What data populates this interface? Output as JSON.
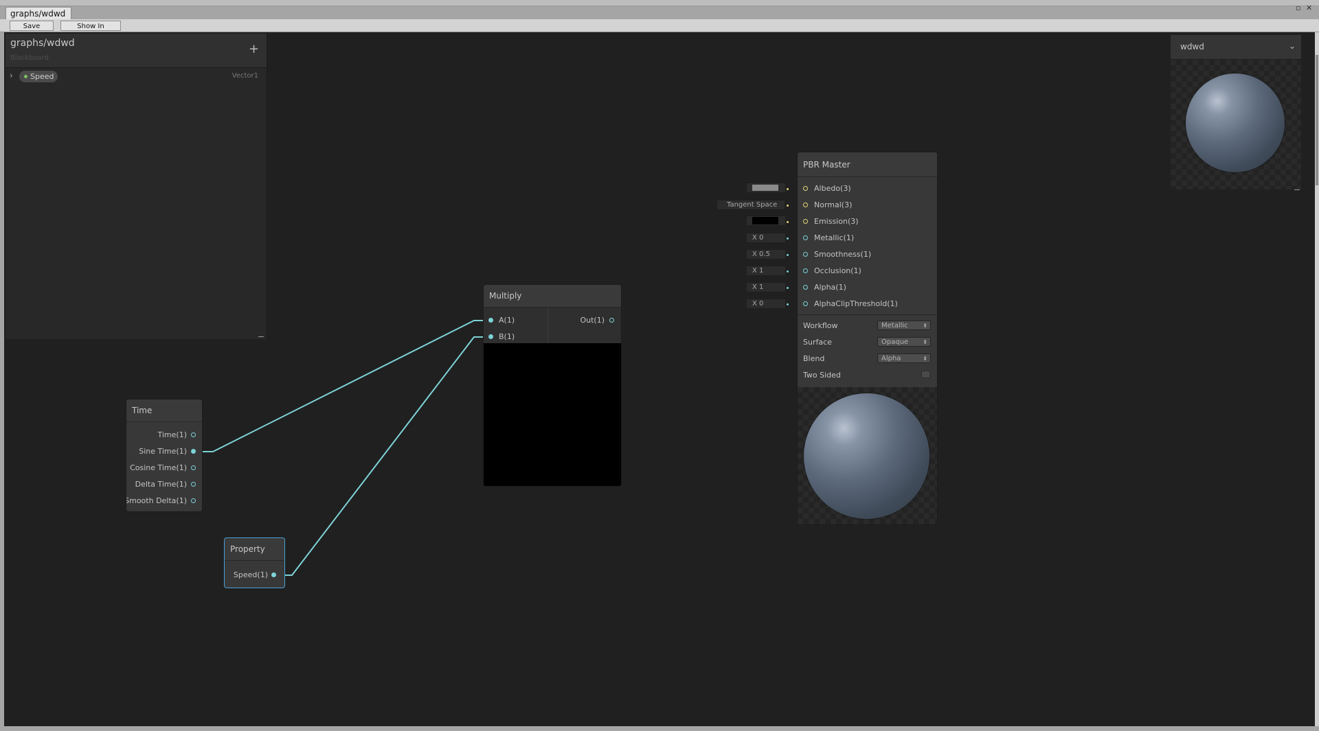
{
  "window": {
    "tab_title": "graphs/wdwd",
    "controls": [
      "▫",
      "✕"
    ]
  },
  "toolbar": {
    "save_asset": "Save Asset",
    "show_in_project": "Show In Project"
  },
  "blackboard": {
    "title": "graphs/wdwd",
    "subtitle": "Blackboard",
    "add_label": "+",
    "properties": [
      {
        "name": "Speed",
        "type": "Vector1"
      }
    ]
  },
  "nodes": {
    "time": {
      "title": "Time",
      "outputs": [
        "Time(1)",
        "Sine Time(1)",
        "Cosine Time(1)",
        "Delta Time(1)",
        "Smooth Delta(1)"
      ]
    },
    "property": {
      "title": "Property",
      "output": "Speed(1)"
    },
    "multiply": {
      "title": "Multiply",
      "inputs": [
        "A(1)",
        "B(1)"
      ],
      "output": "Out(1)"
    },
    "pbr": {
      "title": "PBR Master",
      "inputs": [
        "Albedo(3)",
        "Normal(3)",
        "Emission(3)",
        "Metallic(1)",
        "Smoothness(1)",
        "Occlusion(1)",
        "Alpha(1)",
        "AlphaClipThreshold(1)"
      ],
      "input_values": {
        "albedo_color": "#8a8a8a",
        "normal_space": "Tangent Space",
        "emission_color": "#000000",
        "metallic": "X 0",
        "smoothness": "X 0.5",
        "occlusion": "X 1",
        "alpha": "X 1",
        "alpha_clip": "X 0"
      },
      "settings": {
        "workflow_label": "Workflow",
        "workflow_value": "Metallic",
        "surface_label": "Surface",
        "surface_value": "Opaque",
        "blend_label": "Blend",
        "blend_value": "Alpha",
        "two_sided_label": "Two Sided"
      }
    }
  },
  "main_preview": {
    "title": "wdwd"
  },
  "colors": {
    "edge": "#7dd3d8",
    "vector3_port": "#e6d77a",
    "selection": "#4aa0d8",
    "property_dot": "#7fbf5f"
  }
}
